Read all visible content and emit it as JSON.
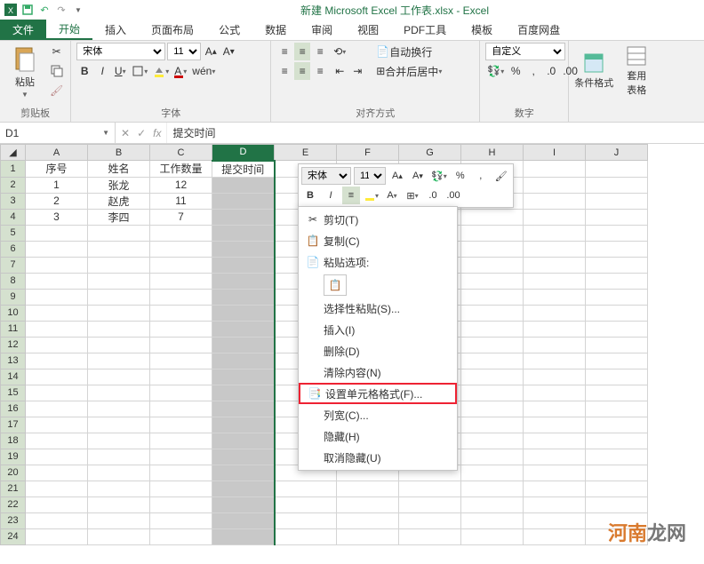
{
  "title": "新建 Microsoft Excel 工作表.xlsx - Excel",
  "tabs": {
    "file": "文件",
    "home": "开始",
    "insert": "插入",
    "layout": "页面布局",
    "formulas": "公式",
    "data": "数据",
    "review": "审阅",
    "view": "视图",
    "pdf": "PDF工具",
    "template": "模板",
    "baidu": "百度网盘"
  },
  "ribbon": {
    "clipboard": {
      "paste": "粘贴",
      "label": "剪贴板"
    },
    "font": {
      "name": "宋体",
      "size": "11",
      "label": "字体"
    },
    "align": {
      "wrap": "自动换行",
      "merge": "合并后居中",
      "label": "对齐方式"
    },
    "number": {
      "format": "自定义",
      "label": "数字"
    },
    "styles": {
      "cond": "条件格式",
      "table": "套用\n表格"
    }
  },
  "namebox": "D1",
  "formula": "提交时间",
  "columns": [
    "A",
    "B",
    "C",
    "D",
    "E",
    "F",
    "G",
    "H",
    "I",
    "J"
  ],
  "headers": {
    "A": "序号",
    "B": "姓名",
    "C": "工作数量",
    "D": "提交时间"
  },
  "rows": [
    {
      "A": "1",
      "B": "张龙",
      "C": "12"
    },
    {
      "A": "2",
      "B": "赵虎",
      "C": "11"
    },
    {
      "A": "3",
      "B": "李四",
      "C": "7"
    }
  ],
  "mini": {
    "font": "宋体",
    "size": "11"
  },
  "ctx": {
    "cut": "剪切(T)",
    "copy": "复制(C)",
    "pasteopt": "粘贴选项:",
    "pastespecial": "选择性粘贴(S)...",
    "insert": "插入(I)",
    "delete": "删除(D)",
    "clear": "清除内容(N)",
    "format": "设置单元格格式(F)...",
    "colwidth": "列宽(C)...",
    "hide": "隐藏(H)",
    "unhide": "取消隐藏(U)"
  },
  "watermark": {
    "a": "河南",
    "b": "龙网"
  }
}
